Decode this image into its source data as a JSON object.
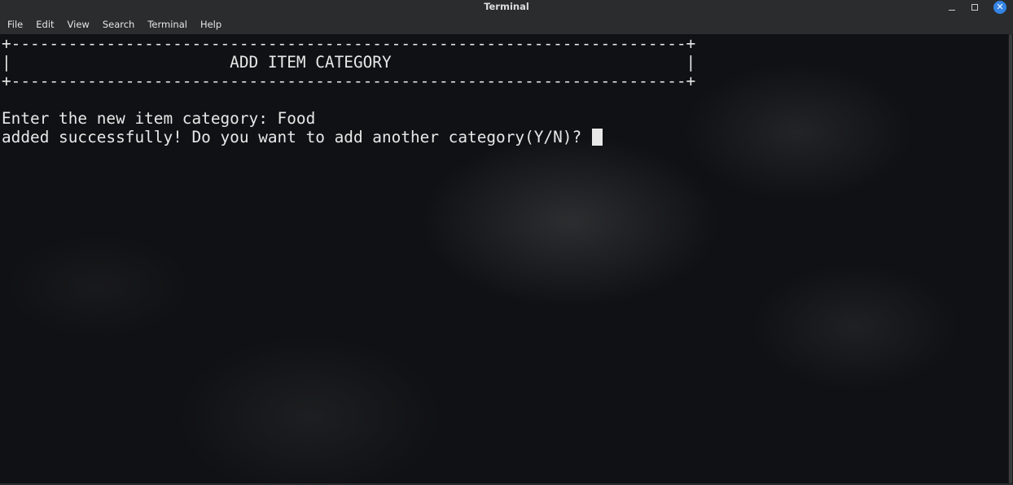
{
  "window": {
    "title": "Terminal",
    "controls": {
      "minimize": "–",
      "maximize": "□",
      "close": "✕"
    }
  },
  "menubar": {
    "items": [
      "File",
      "Edit",
      "View",
      "Search",
      "Terminal",
      "Help"
    ]
  },
  "terminal": {
    "box_top": "+-----------------------------------------------------------------------+",
    "box_title": "|                       ADD ITEM CATEGORY                               |",
    "box_bottom": "+-----------------------------------------------------------------------+",
    "prompt_line": "Enter the new item category: Food",
    "result_line": "added successfully! Do you want to add another category(Y/N)? "
  },
  "icons": {
    "minimize": "minimize-icon",
    "maximize": "maximize-icon",
    "close": "close-icon",
    "cursor": "text-cursor"
  },
  "colors": {
    "titlebar": "#2b2c2e",
    "terminal_bg": "#101114",
    "terminal_fg": "#e8e8e8",
    "close_button": "#3584e4"
  }
}
